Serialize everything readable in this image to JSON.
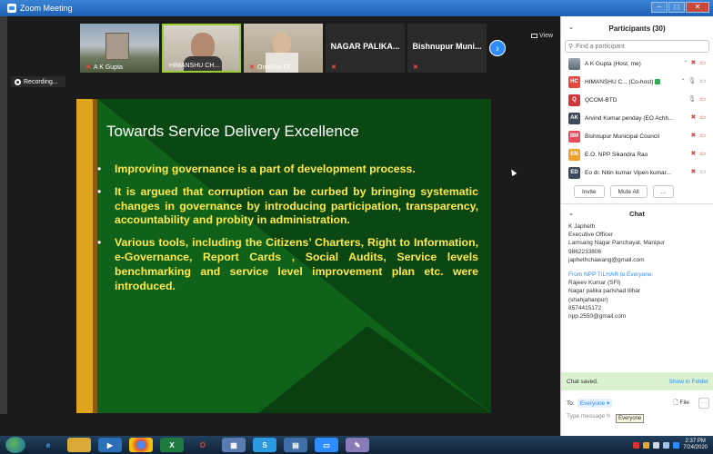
{
  "window": {
    "title": "Zoom Meeting"
  },
  "toolbar": {
    "view_label": "View",
    "recording_label": "Recording..."
  },
  "thumbnails": [
    {
      "name": "A K Gupta"
    },
    {
      "name": "HIMANSHU CH..."
    },
    {
      "name": "OnePlus 6T"
    },
    {
      "name": "NAGAR PALIKA..."
    },
    {
      "name": "Bishnupur Muni..."
    }
  ],
  "slide": {
    "title": "Towards Service Delivery Excellence",
    "bullets": [
      "Improving governance is a part of development process.",
      "It is argued that corruption can be curbed by bringing systematic changes in governance by introducing participation, transparency, accountability and probity in administration.",
      "Various tools, including the Citizens’ Charters, Right to Information, e-Governance, Report Cards , Social Audits, Service levels benchmarking and service level improvement plan  etc. were introduced."
    ]
  },
  "participants": {
    "header": "Participants (30)",
    "search_placeholder": "Find a participant",
    "list": [
      {
        "initials": "",
        "name": "A K Gupta (Host, me)",
        "color": ""
      },
      {
        "initials": "HC",
        "name": "HIMANSHU C... (Co-host)",
        "color": "#e2483b"
      },
      {
        "initials": "Q",
        "name": "QCOM-BTD",
        "color": "#d1353c"
      },
      {
        "initials": "AK",
        "name": "Arvind Kumar penday (EO Achh...",
        "color": "#3b4a5c"
      },
      {
        "initials": "BM",
        "name": "Bishnupur Municipal Council",
        "color": "#e64d5c"
      },
      {
        "initials": "EN",
        "name": "E.O. NPP Sikandra Rao",
        "color": "#f0a12c"
      },
      {
        "initials": "ED",
        "name": "Eo dr. Nitin kumar Vipen kumar...",
        "color": "#3b4a5c"
      }
    ],
    "invite_label": "Invite",
    "mute_all_label": "Mute All",
    "more_label": "..."
  },
  "chat": {
    "header": "Chat",
    "lines_a": [
      "K Japheth",
      "Executive Officer",
      "Lamsang Nagar Panchayat, Manipur",
      "9862233806",
      "japhethchawang@gmail.com"
    ],
    "from_label": "From NPP TILHAR to Everyone:",
    "lines_b": [
      "Rajeev Kumar (SFI)",
      "Nagar palika parishad tilhar",
      "(shahjahanpur)",
      "8574415172",
      "npp.2550@gmail.com"
    ],
    "saved_label": "Chat saved.",
    "show_folder_label": "Show in Folder",
    "to_label": "To:",
    "to_value": "Everyone ▾",
    "file_label": "File",
    "more_label": "···",
    "input_placeholder": "Type message h",
    "tooltip": "Everyone"
  },
  "taskbar": {
    "time": "2:37 PM",
    "date": "7/24/2020"
  }
}
